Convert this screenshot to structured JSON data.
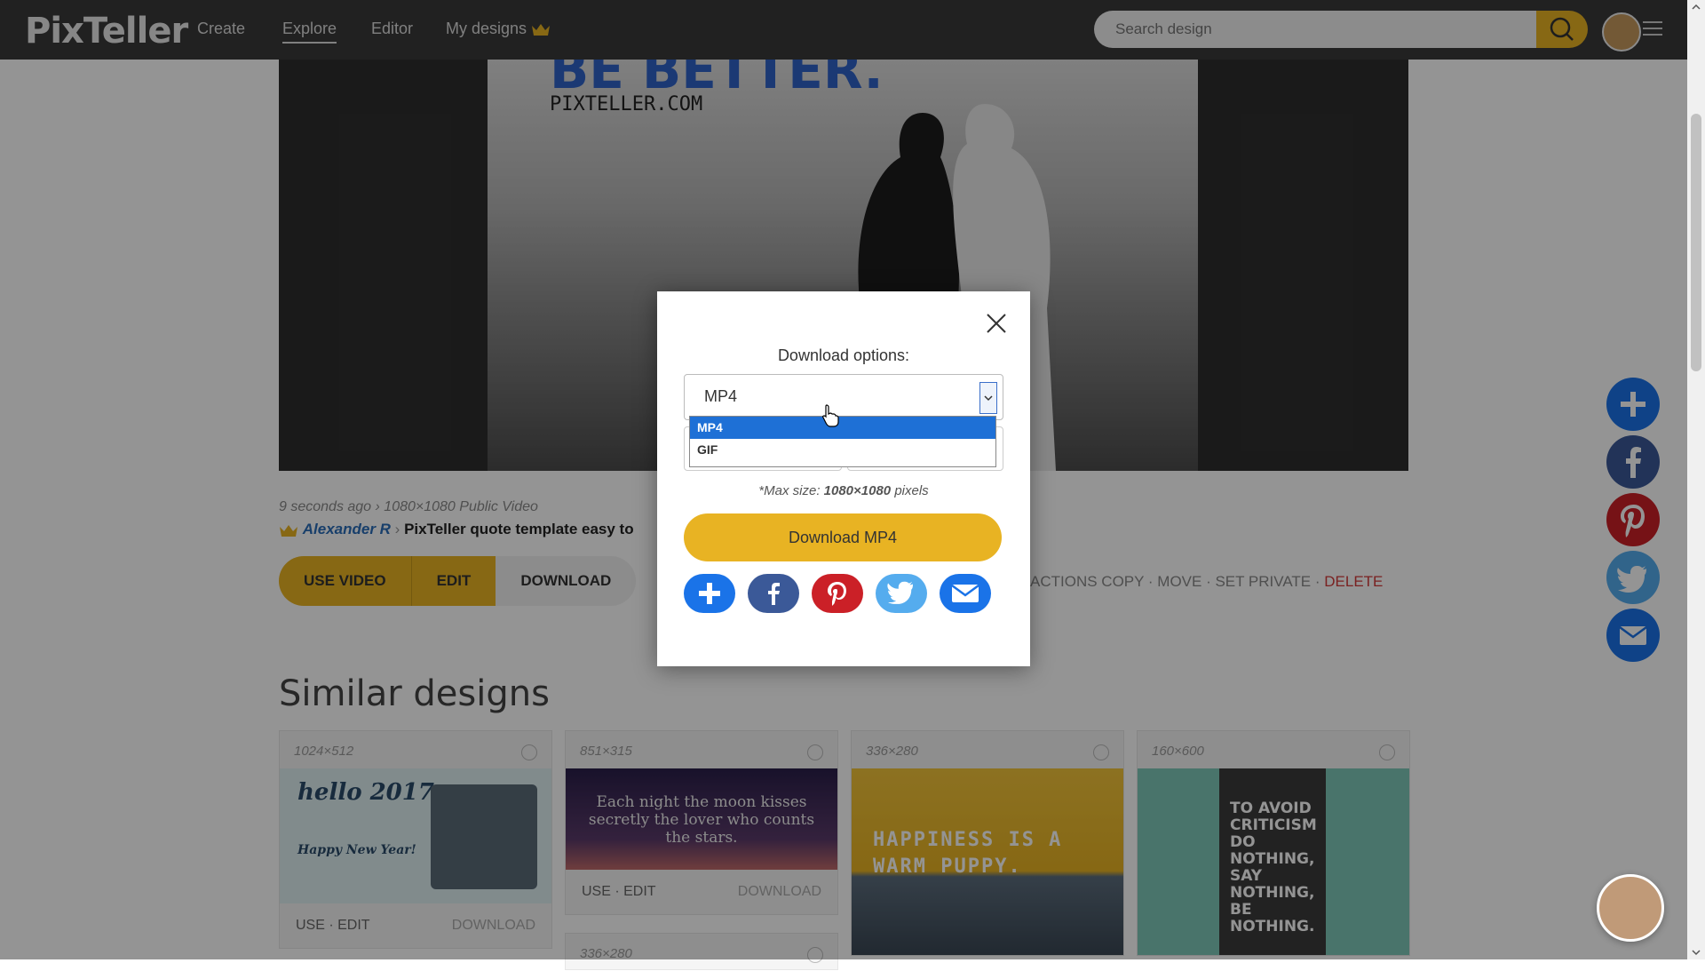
{
  "nav": {
    "logo": "PixTeller",
    "items": [
      "Create",
      "Explore",
      "Editor",
      "My designs"
    ],
    "search_placeholder": "Search design"
  },
  "hero": {
    "title": "BE BETTER.",
    "url": "PIXTELLER.COM"
  },
  "meta": {
    "time": "9 seconds ago",
    "separator": " › ",
    "info": "1080×1080 Public Video",
    "author": "Alexander R",
    "description": "PixTeller quote template easy to"
  },
  "buttons": {
    "use_video": "USE VIDEO",
    "edit": "EDIT",
    "download": "DOWNLOAD"
  },
  "actions": {
    "label": "ACTIONS",
    "copy": "COPY",
    "move": "MOVE",
    "set_private": "SET PRIVATE",
    "delete": "DELETE",
    "sep": " · "
  },
  "similar": {
    "title": "Similar designs",
    "cards": [
      {
        "size": "1024×512",
        "text1": "hello 2017",
        "text2": "Happy New Year!",
        "use_edit": "USE · EDIT",
        "download": "DOWNLOAD"
      },
      {
        "size": "851×315",
        "text": "Each night the moon kisses secretly the lover who counts the stars.",
        "use_edit": "USE · EDIT",
        "download": "DOWNLOAD",
        "next_size": "336×280"
      },
      {
        "size": "336×280",
        "text": "HAPPINESS IS A WARM PUPPY."
      },
      {
        "size": "160×600",
        "text": "TO AVOID CRITICISM DO NOTHING, SAY NOTHING, BE NOTHING."
      }
    ]
  },
  "modal": {
    "label": "Download options:",
    "selected": "MP4",
    "options": [
      "MP4",
      "GIF"
    ],
    "max_size_prefix": "*Max size: ",
    "max_size_value": "1080×1080",
    "max_size_suffix": " pixels",
    "download_button": "Download MP4"
  },
  "colors": {
    "accent": "#e8b323",
    "addthis": "#1a73e8",
    "facebook": "#3b5998",
    "pinterest": "#cb2027",
    "twitter": "#55acee",
    "email": "#1a73e8",
    "delete": "#d23a3a"
  }
}
